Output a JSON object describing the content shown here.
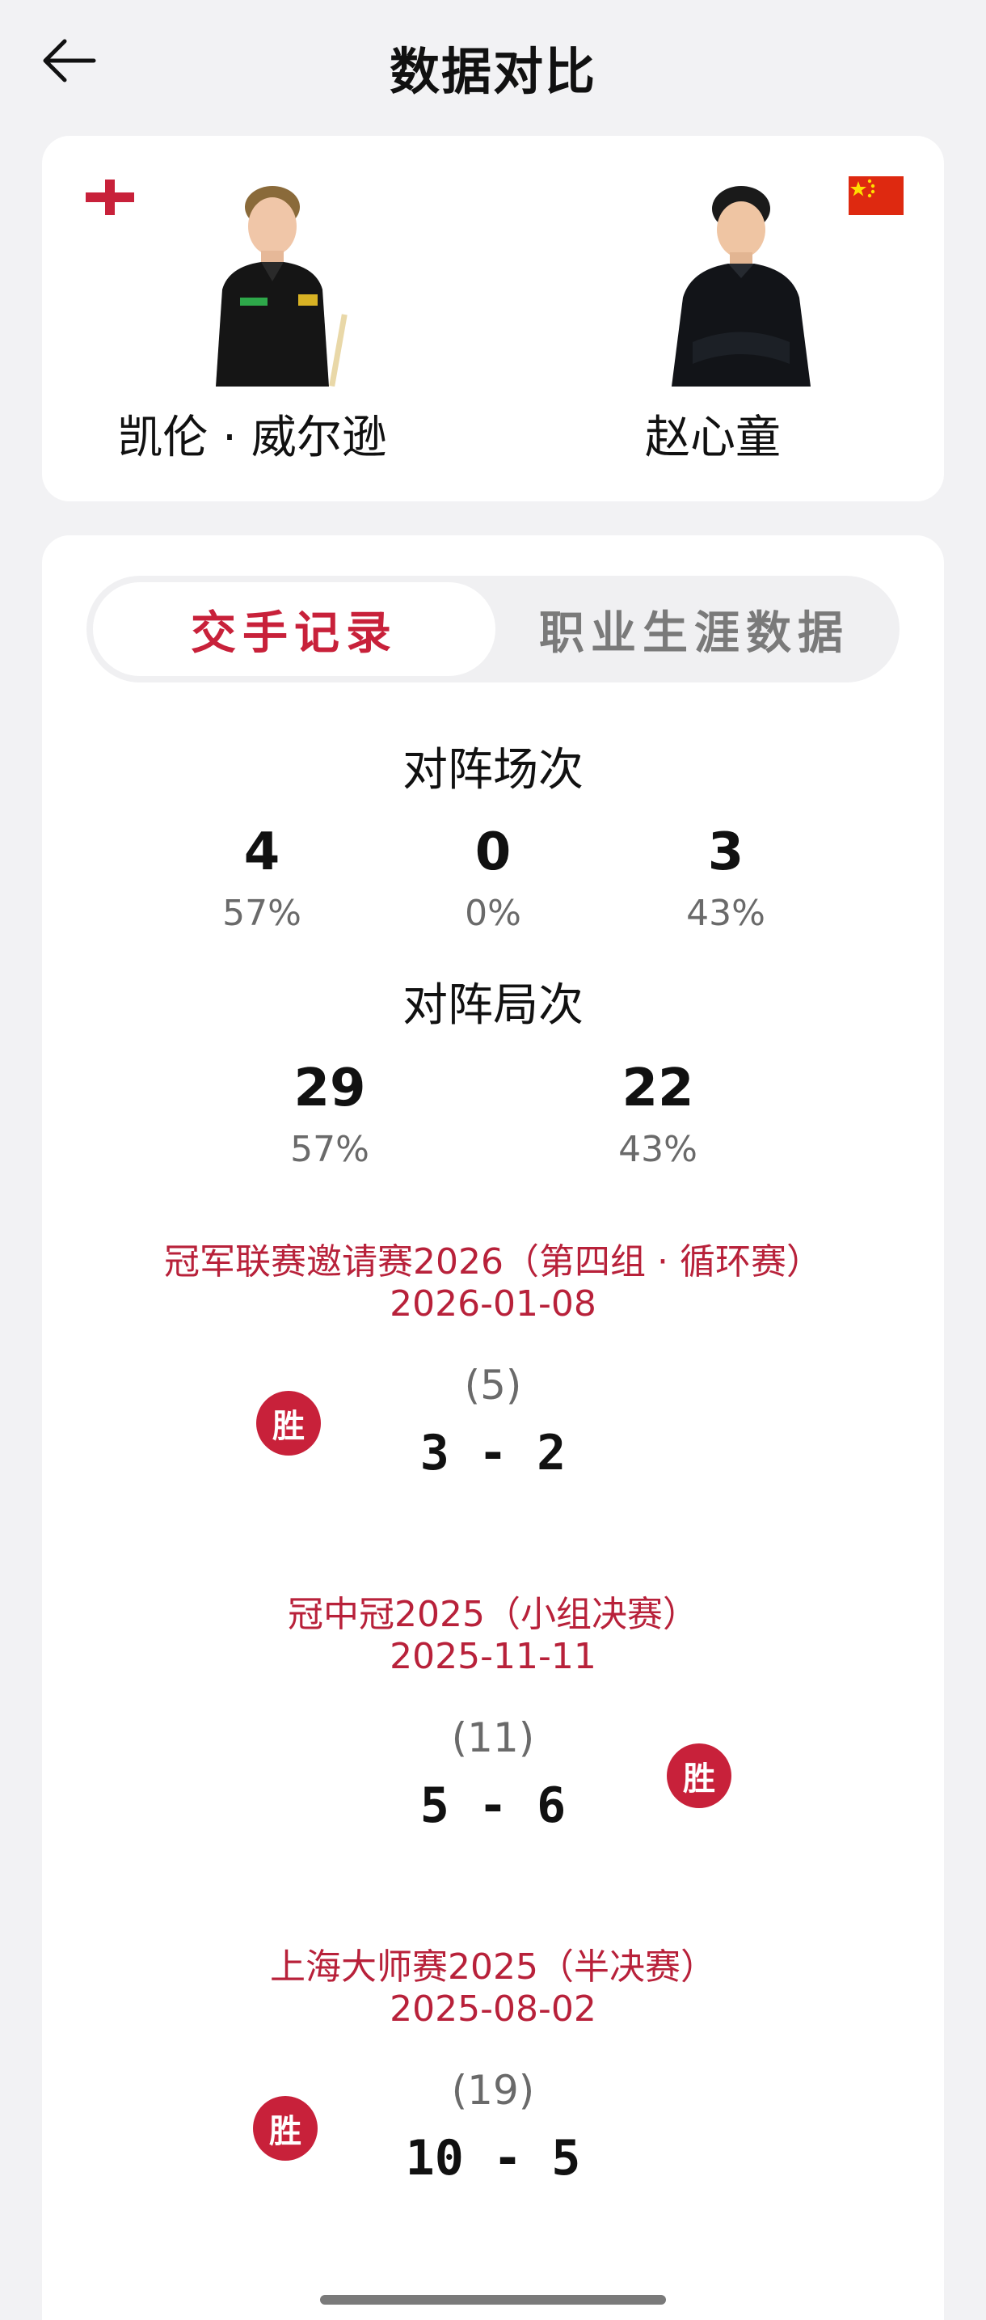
{
  "header": {
    "title": "数据对比",
    "back_icon": "arrow-left-icon"
  },
  "players": {
    "left": {
      "name": "凯伦 · 威尔逊",
      "flag": "england-flag-icon"
    },
    "right": {
      "name": "赵心童",
      "flag": "china-flag-icon"
    }
  },
  "tabs": [
    {
      "label": "交手记录",
      "active": true
    },
    {
      "label": "职业生涯数据",
      "active": false
    }
  ],
  "matches_section": {
    "title": "对阵场次",
    "left": {
      "value": "4",
      "pct": "57%"
    },
    "draw": {
      "value": "0",
      "pct": "0%"
    },
    "right": {
      "value": "3",
      "pct": "43%"
    }
  },
  "frames_section": {
    "title": "对阵局次",
    "left": {
      "value": "29",
      "pct": "57%"
    },
    "right": {
      "value": "22",
      "pct": "43%"
    }
  },
  "history": [
    {
      "event": "冠军联赛邀请赛2026（第四组 · 循环赛）",
      "date": "2026-01-08",
      "frames": "(5)",
      "score": "3 - 2",
      "winner": "left",
      "badge": "胜"
    },
    {
      "event": "冠中冠2025（小组决赛）",
      "date": "2025-11-11",
      "frames": "(11)",
      "score": "5 - 6",
      "winner": "right",
      "badge": "胜"
    },
    {
      "event": "上海大师赛2025（半决赛）",
      "date": "2025-08-02",
      "frames": "(19)",
      "score": "10 - 5",
      "winner": "left",
      "badge": "胜"
    }
  ],
  "colors": {
    "accent": "#c8213a",
    "background": "#f2f2f4",
    "card": "#ffffff"
  }
}
